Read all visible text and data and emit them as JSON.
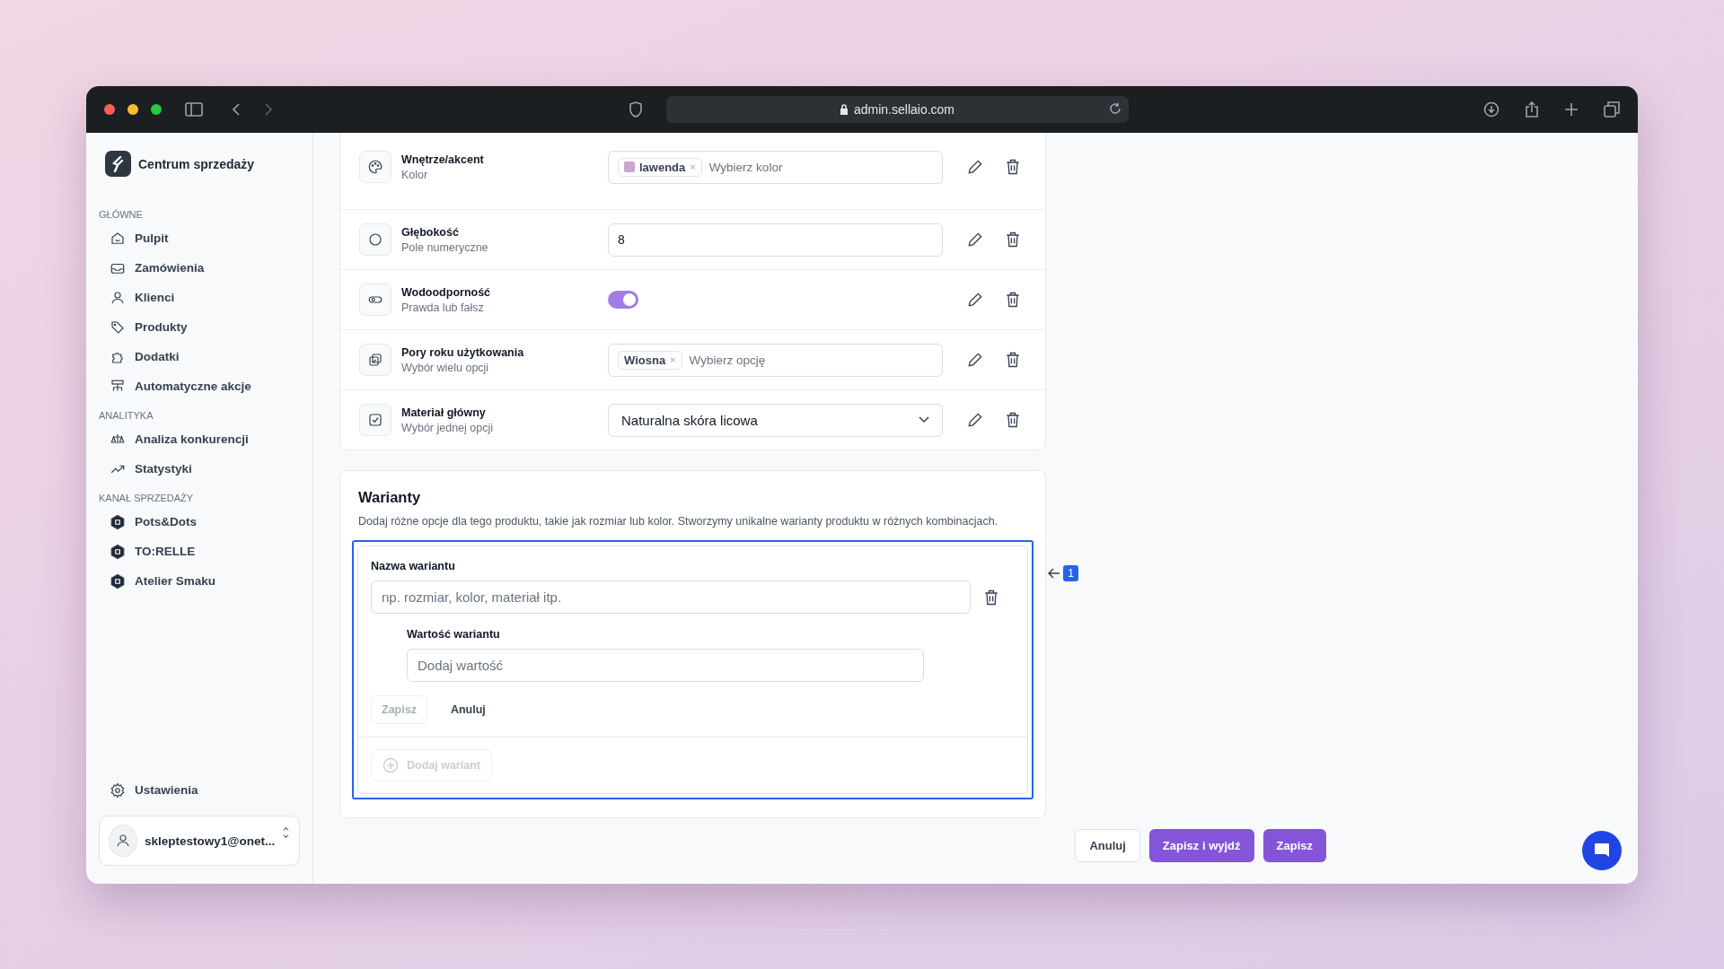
{
  "browser": {
    "url": "admin.sellaio.com"
  },
  "sidebar": {
    "brand": "Centrum sprzedaży",
    "sections": [
      {
        "title": "GŁÓWNE",
        "items": [
          {
            "label": "Pulpit"
          },
          {
            "label": "Zamówienia"
          },
          {
            "label": "Klienci"
          },
          {
            "label": "Produkty"
          },
          {
            "label": "Dodatki"
          },
          {
            "label": "Automatyczne akcje"
          }
        ]
      },
      {
        "title": "ANALITYKA",
        "items": [
          {
            "label": "Analiza konkurencji"
          },
          {
            "label": "Statystyki"
          }
        ]
      },
      {
        "title": "KANAŁ SPRZEDAŻY",
        "items": [
          {
            "label": "Pots&Dots"
          },
          {
            "label": "TO:RELLE"
          },
          {
            "label": "Atelier Smaku"
          }
        ]
      }
    ],
    "settings": "Ustawienia",
    "account": "skleptestowy1@onet..."
  },
  "attributes": [
    {
      "kind": "tags",
      "name": "Wnętrze/akcent",
      "type": "Kolor",
      "tags": [
        {
          "label": "lawenda",
          "color": "#cfa3cf",
          "remove": "×"
        }
      ],
      "placeholder": "Wybierz kolor"
    },
    {
      "kind": "number",
      "name": "Głębokość",
      "type": "Pole numeryczne",
      "value": "8"
    },
    {
      "kind": "toggle",
      "name": "Wodoodporność",
      "type": "Prawda lub fałsz",
      "on": true
    },
    {
      "kind": "multi",
      "name": "Pory roku użytkowania",
      "type": "Wybór wielu opcji",
      "tags": [
        {
          "label": "Wiosna",
          "remove": "×"
        }
      ],
      "placeholder": "Wybierz opcję"
    },
    {
      "kind": "select",
      "name": "Materiał główny",
      "type": "Wybór jednej opcji",
      "value": "Naturalna skóra licowa"
    }
  ],
  "variants": {
    "title": "Warianty",
    "description": "Dodaj różne opcje dla tego produktu, takie jak rozmiar lub kolor. Stworzymy unikalne warianty produktu w różnych kombinacjach.",
    "name_label": "Nazwa wariantu",
    "name_placeholder": "np. rozmiar, kolor, materiał itp.",
    "value_label": "Wartość wariantu",
    "value_placeholder": "Dodaj wartość",
    "save": "Zapisz",
    "save_disabled": true,
    "cancel": "Anuluj",
    "add": "Dodaj wariant",
    "add_disabled": true,
    "annotation": "1"
  },
  "footer": {
    "buttons": [
      {
        "label": "Anuluj",
        "kind": "secondary"
      },
      {
        "label": "Zapisz i wyjdź",
        "kind": "primary"
      },
      {
        "label": "Zapisz",
        "kind": "primary"
      }
    ]
  }
}
